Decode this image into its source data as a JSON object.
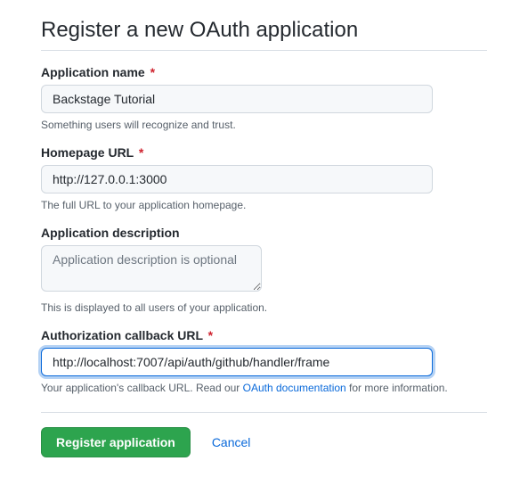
{
  "heading": "Register a new OAuth application",
  "fields": {
    "app_name": {
      "label": "Application name",
      "value": "Backstage Tutorial",
      "help": "Something users will recognize and trust."
    },
    "homepage_url": {
      "label": "Homepage URL",
      "value": "http://127.0.0.1:3000",
      "help": "The full URL to your application homepage."
    },
    "description": {
      "label": "Application description",
      "placeholder": "Application description is optional",
      "help": "This is displayed to all users of your application."
    },
    "callback_url": {
      "label": "Authorization callback URL",
      "value": "http://localhost:7007/api/auth/github/handler/frame",
      "help_before": "Your application's callback URL. Read our ",
      "help_link": "OAuth documentation",
      "help_after": " for more information."
    }
  },
  "actions": {
    "submit": "Register application",
    "cancel": "Cancel"
  },
  "required_marker": "*"
}
